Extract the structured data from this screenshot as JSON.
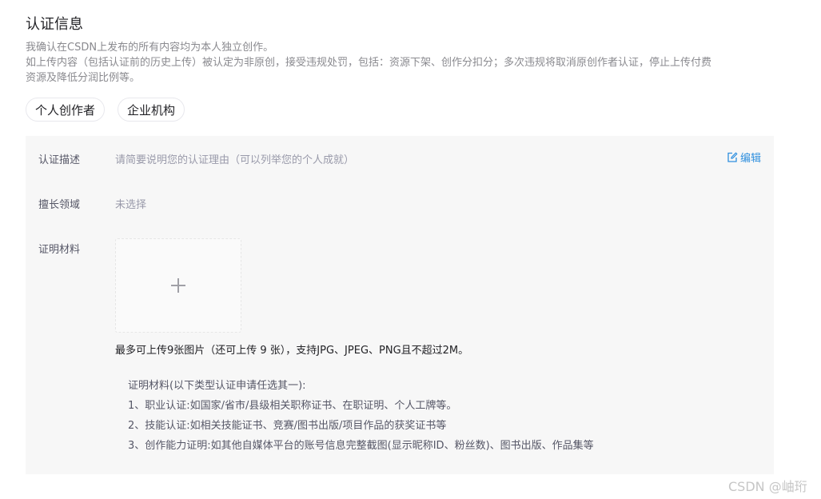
{
  "header": {
    "title": "认证信息"
  },
  "notice": {
    "line1": "我确认在CSDN上发布的所有内容均为本人独立创作。",
    "line2": "如上传内容（包括认证前的历史上传）被认定为非原创，接受违规处罚，包括：资源下架、创作分扣分；多次违规将取消原创作者认证，停止上传付费",
    "line3": "资源及降低分润比例等。"
  },
  "creator_types": [
    {
      "label": "个人创作者"
    },
    {
      "label": "企业机构"
    }
  ],
  "form": {
    "description": {
      "label": "认证描述",
      "placeholder": "请简要说明您的认证理由（可以列举您的个人成就）"
    },
    "edit_label": "编辑",
    "expertise": {
      "label": "擅长领域",
      "value": "未选择"
    },
    "materials": {
      "label": "证明材料",
      "upload_hint": "最多可上传9张图片（还可上传 9 张），支持JPG、JPEG、PNG且不超过2M。",
      "info_title": "证明材料(以下类型认证申请任选其一):",
      "info_items": [
        "1、职业认证:如国家/省市/县级相关职称证书、在职证明、个人工牌等。",
        "2、技能认证:如相关技能证书、竞赛/图书出版/项目作品的获奖证书等",
        "3、创作能力证明:如其他自媒体平台的账号信息完整截图(显示昵称ID、粉丝数)、图书出版、作品集等"
      ]
    }
  },
  "watermark": "CSDN @岫珩",
  "colors": {
    "accent": "#2f8fde",
    "panel_bg": "#f7f7f7"
  },
  "icons": {
    "edit": "edit-icon",
    "upload": "plus-icon"
  }
}
